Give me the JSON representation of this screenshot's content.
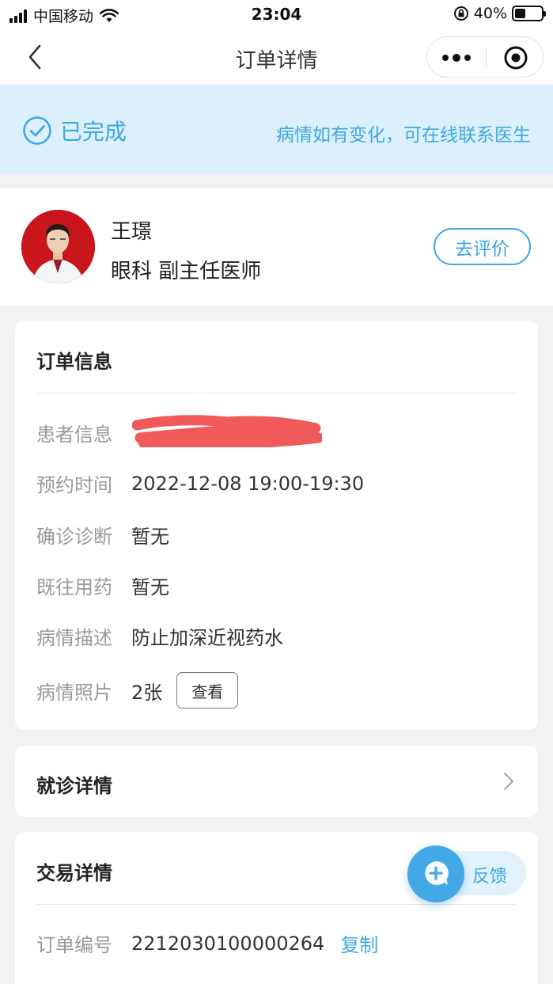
{
  "status_bar": {
    "carrier": "中国移动",
    "time": "23:04",
    "battery": "40%",
    "battery_level": 0.4
  },
  "nav": {
    "title": "订单详情"
  },
  "banner": {
    "status": "已完成",
    "tip": "病情如有变化，可在线联系医生"
  },
  "doctor": {
    "name": "王璟",
    "title": "眼科 副主任医师",
    "rate_label": "去评价"
  },
  "order_info": {
    "title": "订单信息",
    "rows": [
      {
        "label": "患者信息",
        "value": ""
      },
      {
        "label": "预约时间",
        "value": "2022-12-08 19:00-19:30"
      },
      {
        "label": "确诊诊断",
        "value": "暂无"
      },
      {
        "label": "既往用药",
        "value": "暂无"
      },
      {
        "label": "病情描述",
        "value": "防止加深近视药水"
      },
      {
        "label": "病情照片",
        "value": "2张"
      }
    ],
    "view_label": "查看"
  },
  "visit": {
    "title": "就诊详情"
  },
  "trade": {
    "title": "交易详情",
    "order_no_label": "订单编号",
    "order_no": "2212030100000264",
    "copy_label": "复制"
  },
  "feedback": {
    "label": "反馈"
  },
  "colors": {
    "accent": "#3ea8e0",
    "banner_bg": "#dcf0fb",
    "redaction": "#f05a5a"
  }
}
